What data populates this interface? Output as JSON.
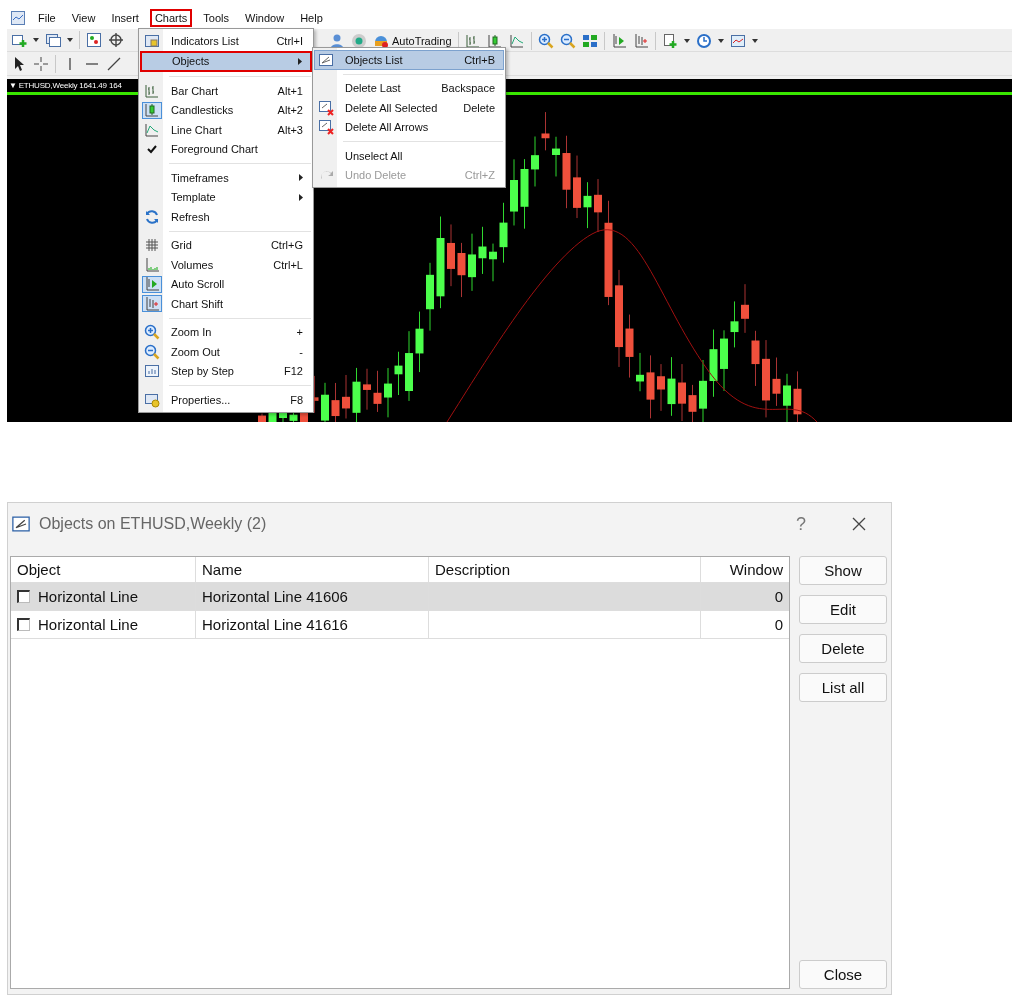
{
  "menu_bar": [
    {
      "label": "File",
      "selected": false
    },
    {
      "label": "View",
      "selected": false
    },
    {
      "label": "Insert",
      "selected": false
    },
    {
      "label": "Charts",
      "selected": true
    },
    {
      "label": "Tools",
      "selected": false
    },
    {
      "label": "Window",
      "selected": false
    },
    {
      "label": "Help",
      "selected": false
    }
  ],
  "toolbar": {
    "autotrading_label": "AutoTrading"
  },
  "chart": {
    "arrow": "▼",
    "title": "ETHUSD,Weekly  1641.49 164"
  },
  "charts_menu": {
    "groups": [
      [
        {
          "label": "Indicators List",
          "shortcut": "Ctrl+I",
          "submenu": false,
          "selected": false,
          "checked": false,
          "on": false
        },
        {
          "label": "Objects",
          "submenu": true,
          "selected": true,
          "checked": false,
          "on": false
        }
      ],
      [
        {
          "label": "Bar Chart",
          "shortcut": "Alt+1",
          "submenu": false,
          "selected": false,
          "checked": false,
          "on": false
        },
        {
          "label": "Candlesticks",
          "shortcut": "Alt+2",
          "submenu": false,
          "selected": false,
          "checked": false,
          "on": true
        },
        {
          "label": "Line Chart",
          "shortcut": "Alt+3",
          "submenu": false,
          "selected": false,
          "checked": false,
          "on": false
        },
        {
          "label": "Foreground Chart",
          "submenu": false,
          "selected": false,
          "checked": true,
          "on": false
        }
      ],
      [
        {
          "label": "Timeframes",
          "submenu": true,
          "selected": false,
          "checked": false,
          "on": false
        },
        {
          "label": "Template",
          "submenu": true,
          "selected": false,
          "checked": false,
          "on": false
        },
        {
          "label": "Refresh",
          "submenu": false,
          "selected": false,
          "checked": false,
          "on": false
        }
      ],
      [
        {
          "label": "Grid",
          "shortcut": "Ctrl+G",
          "submenu": false,
          "selected": false,
          "checked": false,
          "on": false
        },
        {
          "label": "Volumes",
          "shortcut": "Ctrl+L",
          "submenu": false,
          "selected": false,
          "checked": false,
          "on": false
        },
        {
          "label": "Auto Scroll",
          "submenu": false,
          "selected": false,
          "checked": false,
          "on": true
        },
        {
          "label": "Chart Shift",
          "submenu": false,
          "selected": false,
          "checked": false,
          "on": true
        }
      ],
      [
        {
          "label": "Zoom In",
          "shortcut": "+",
          "submenu": false,
          "selected": false,
          "checked": false,
          "on": false
        },
        {
          "label": "Zoom Out",
          "shortcut": "-",
          "submenu": false,
          "selected": false,
          "checked": false,
          "on": false
        },
        {
          "label": "Step by Step",
          "shortcut": "F12",
          "submenu": false,
          "selected": false,
          "checked": false,
          "on": false
        }
      ],
      [
        {
          "label": "Properties...",
          "shortcut": "F8",
          "submenu": false,
          "selected": false,
          "checked": false,
          "on": false
        }
      ]
    ]
  },
  "objects_submenu": {
    "groups": [
      [
        {
          "label": "Objects List",
          "shortcut": "Ctrl+B",
          "selected": true,
          "disabled": false
        }
      ],
      [
        {
          "label": "Delete Last",
          "shortcut": "Backspace",
          "selected": false,
          "disabled": false
        },
        {
          "label": "Delete All Selected",
          "shortcut": "Delete",
          "selected": false,
          "disabled": false
        },
        {
          "label": "Delete All Arrows",
          "selected": false,
          "disabled": false
        }
      ],
      [
        {
          "label": "Unselect All",
          "selected": false,
          "disabled": false
        },
        {
          "label": "Undo Delete",
          "shortcut": "Ctrl+Z",
          "selected": false,
          "disabled": true
        }
      ]
    ]
  },
  "dialog": {
    "title": "Objects on ETHUSD,Weekly (2)",
    "help": "?",
    "columns": [
      "Object",
      "Name",
      "Description",
      "Window"
    ],
    "rows": [
      {
        "object": "Horizontal Line",
        "name": "Horizontal Line 41606",
        "window": "0",
        "checked": false,
        "selected": true
      },
      {
        "object": "Horizontal Line",
        "name": "Horizontal Line 41616",
        "window": "0",
        "checked": false,
        "selected": false
      }
    ],
    "buttons": [
      "Show",
      "Edit",
      "Delete",
      "List all"
    ],
    "close_button": "Close"
  }
}
